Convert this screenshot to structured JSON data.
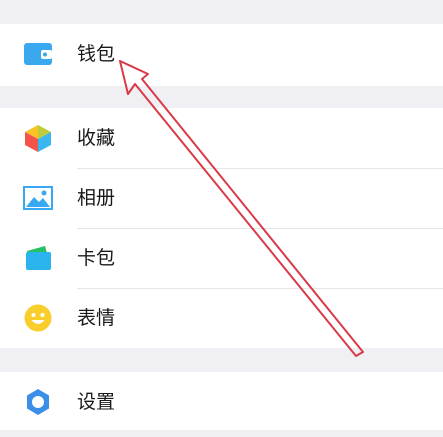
{
  "menu": {
    "wallet": {
      "label": "钱包",
      "icon": "wallet-icon",
      "color": "#3aa8ee"
    },
    "favorites": {
      "label": "收藏",
      "icon": "cube-icon"
    },
    "album": {
      "label": "相册",
      "icon": "picture-icon",
      "color": "#37a9f2"
    },
    "cards": {
      "label": "卡包",
      "icon": "card-icon",
      "color": "#25c061"
    },
    "stickers": {
      "label": "表情",
      "icon": "smiley-icon",
      "color": "#f9cd2a"
    },
    "settings": {
      "label": "设置",
      "icon": "gear-icon",
      "color": "#3a8fe8"
    }
  },
  "annotation": {
    "type": "arrow",
    "color": "#d93a48"
  }
}
